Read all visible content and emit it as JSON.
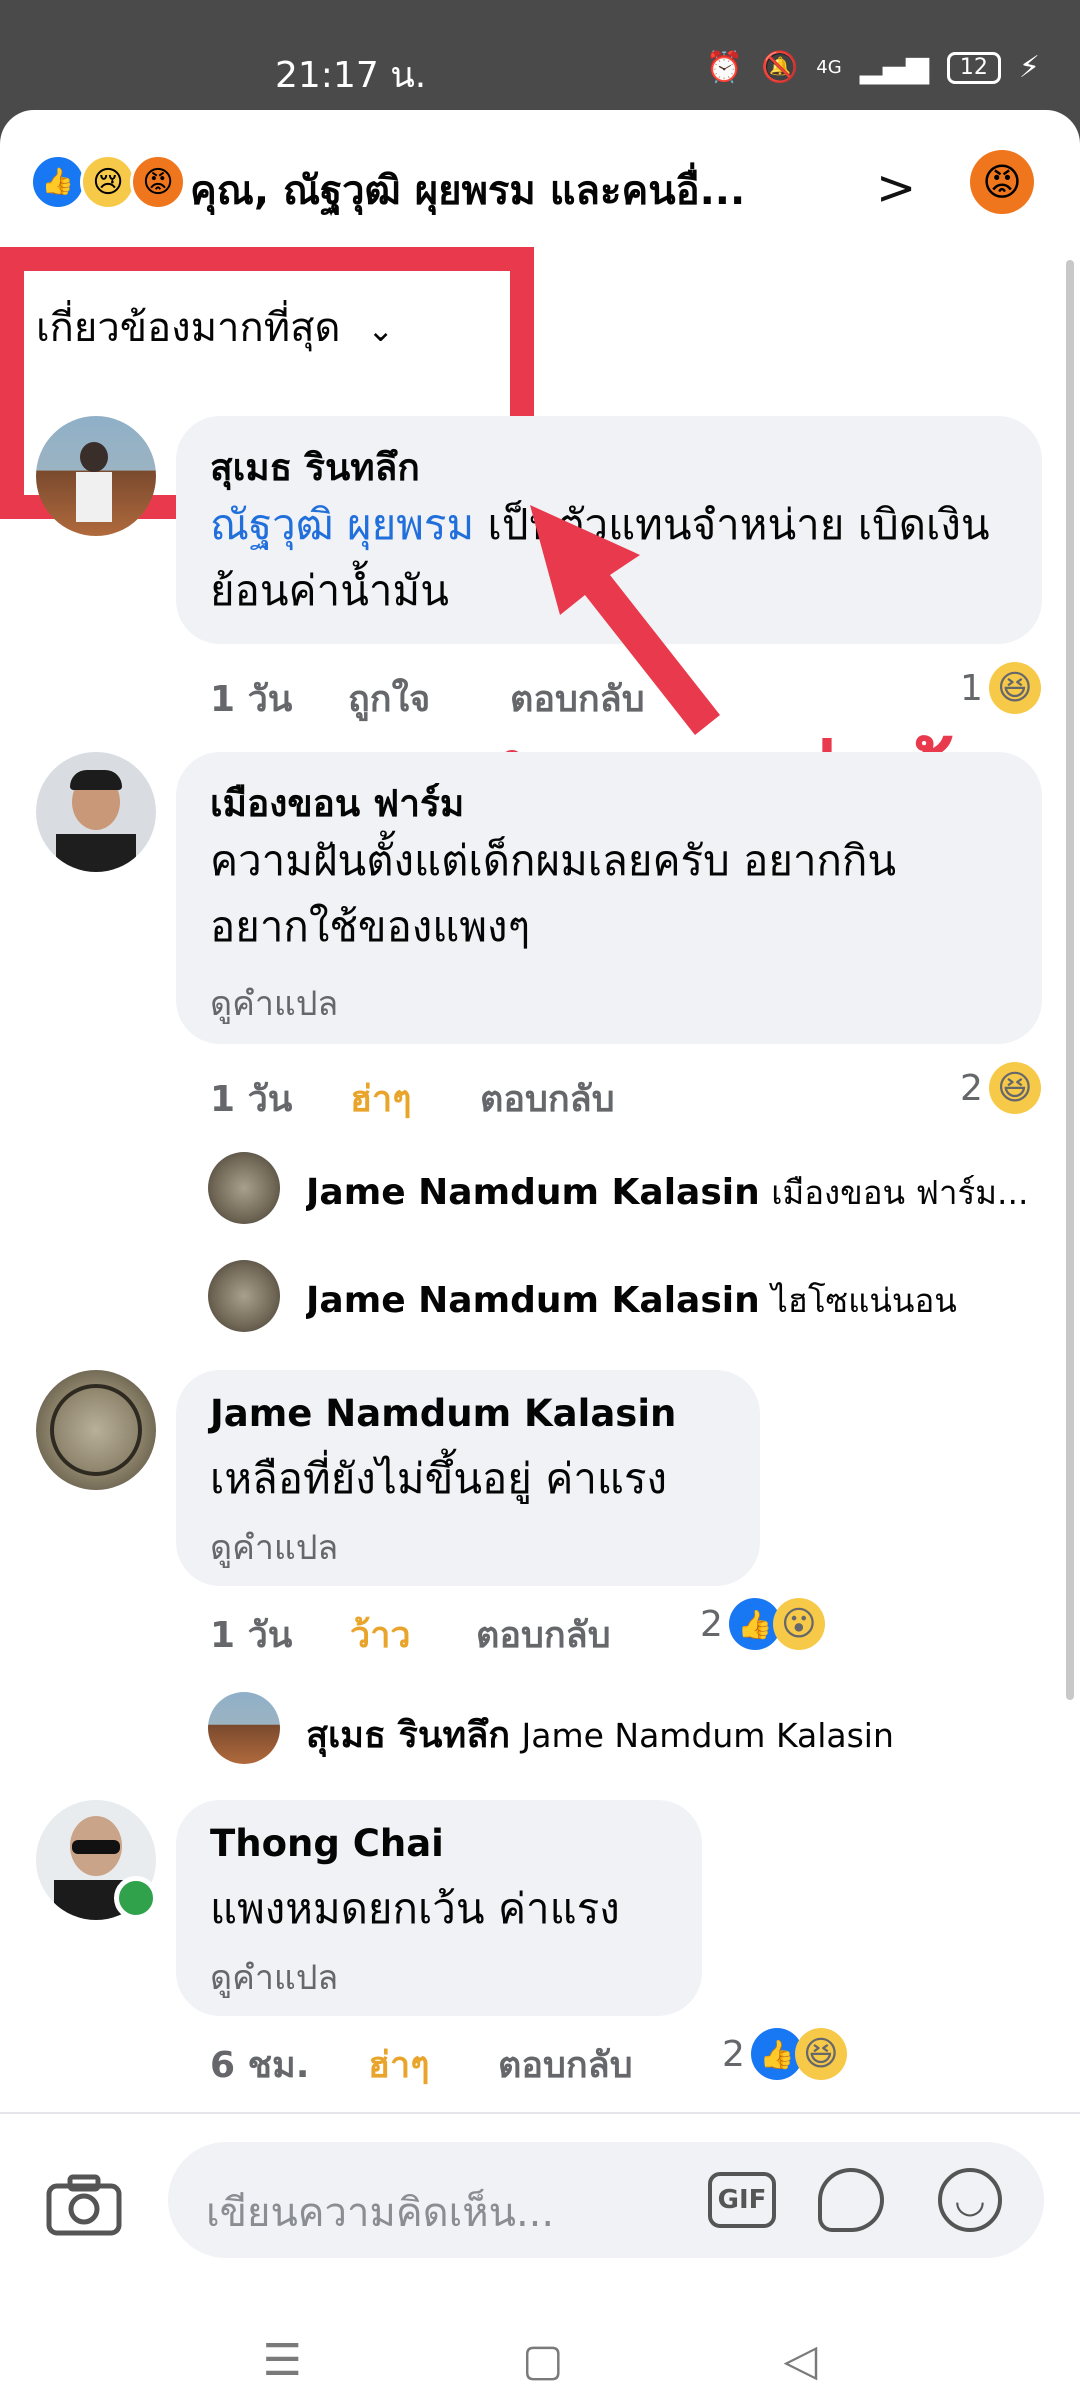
{
  "status": {
    "time": "21:17 น.",
    "battery": "12",
    "network": "4G"
  },
  "header": {
    "title": "คุณ, ณัฐวุฒิ ผุยพรม และคนอื่...",
    "reacts": [
      "like-icon",
      "sad-icon",
      "angry-icon"
    ]
  },
  "sort": {
    "label": "เกี่ยวข้องมากที่สุด",
    "chevron": "chevron-down-icon"
  },
  "overlay": {
    "text": "ไม่ชอบสิ่งนี้",
    "annotation_color": "#e9394d"
  },
  "comments": [
    {
      "author": "สุเมธ รินทลึก",
      "mention": "ณัฐวุฒิ ผุยพรม",
      "text_line1": " เป็นตัวแทนจำหน่าย เบิดเงิน",
      "text_line2": "ย้อนค่าน้ำมัน",
      "time": "1 วัน",
      "action": "ถูกใจ",
      "reply": "ตอบกลับ",
      "count": "1"
    },
    {
      "author": "เมืองขอน ฟาร์ม",
      "text_line1": "ความฝันตั้งแต่เด็กผมเลยครับ อยากกิน",
      "text_line2": "อยากใช้ของแพงๆ",
      "translate": "ดูคำแปล",
      "time": "1 วัน",
      "action": "ฮ่าๆ",
      "reply": "ตอบกลับ",
      "count": "2",
      "replies": [
        {
          "author": "Jame Namdum Kalasin",
          "text": "เมืองขอน ฟาร์ม..."
        },
        {
          "author": "Jame Namdum Kalasin",
          "text": "ไฮโซแน่นอน"
        }
      ]
    },
    {
      "author": "Jame Namdum Kalasin",
      "text_line1": "เหลือที่ยังไม่ขึ้นอยู่ ค่าแรง",
      "translate": "ดูคำแปล",
      "time": "1 วัน",
      "action": "ว้าว",
      "reply": "ตอบกลับ",
      "count": "2",
      "replies": [
        {
          "author": "สุเมธ รินทลึก",
          "text": "Jame Namdum Kalasin"
        }
      ]
    },
    {
      "author": "Thong Chai",
      "text_line1": "แพงหมดยกเว้น ค่าแรง",
      "translate": "ดูคำแปล",
      "time": "6 ชม.",
      "action": "ฮ่าๆ",
      "reply": "ตอบกลับ",
      "count": "2"
    }
  ],
  "composer": {
    "placeholder": "เขียนความคิดเห็น...",
    "gif": "GIF"
  }
}
